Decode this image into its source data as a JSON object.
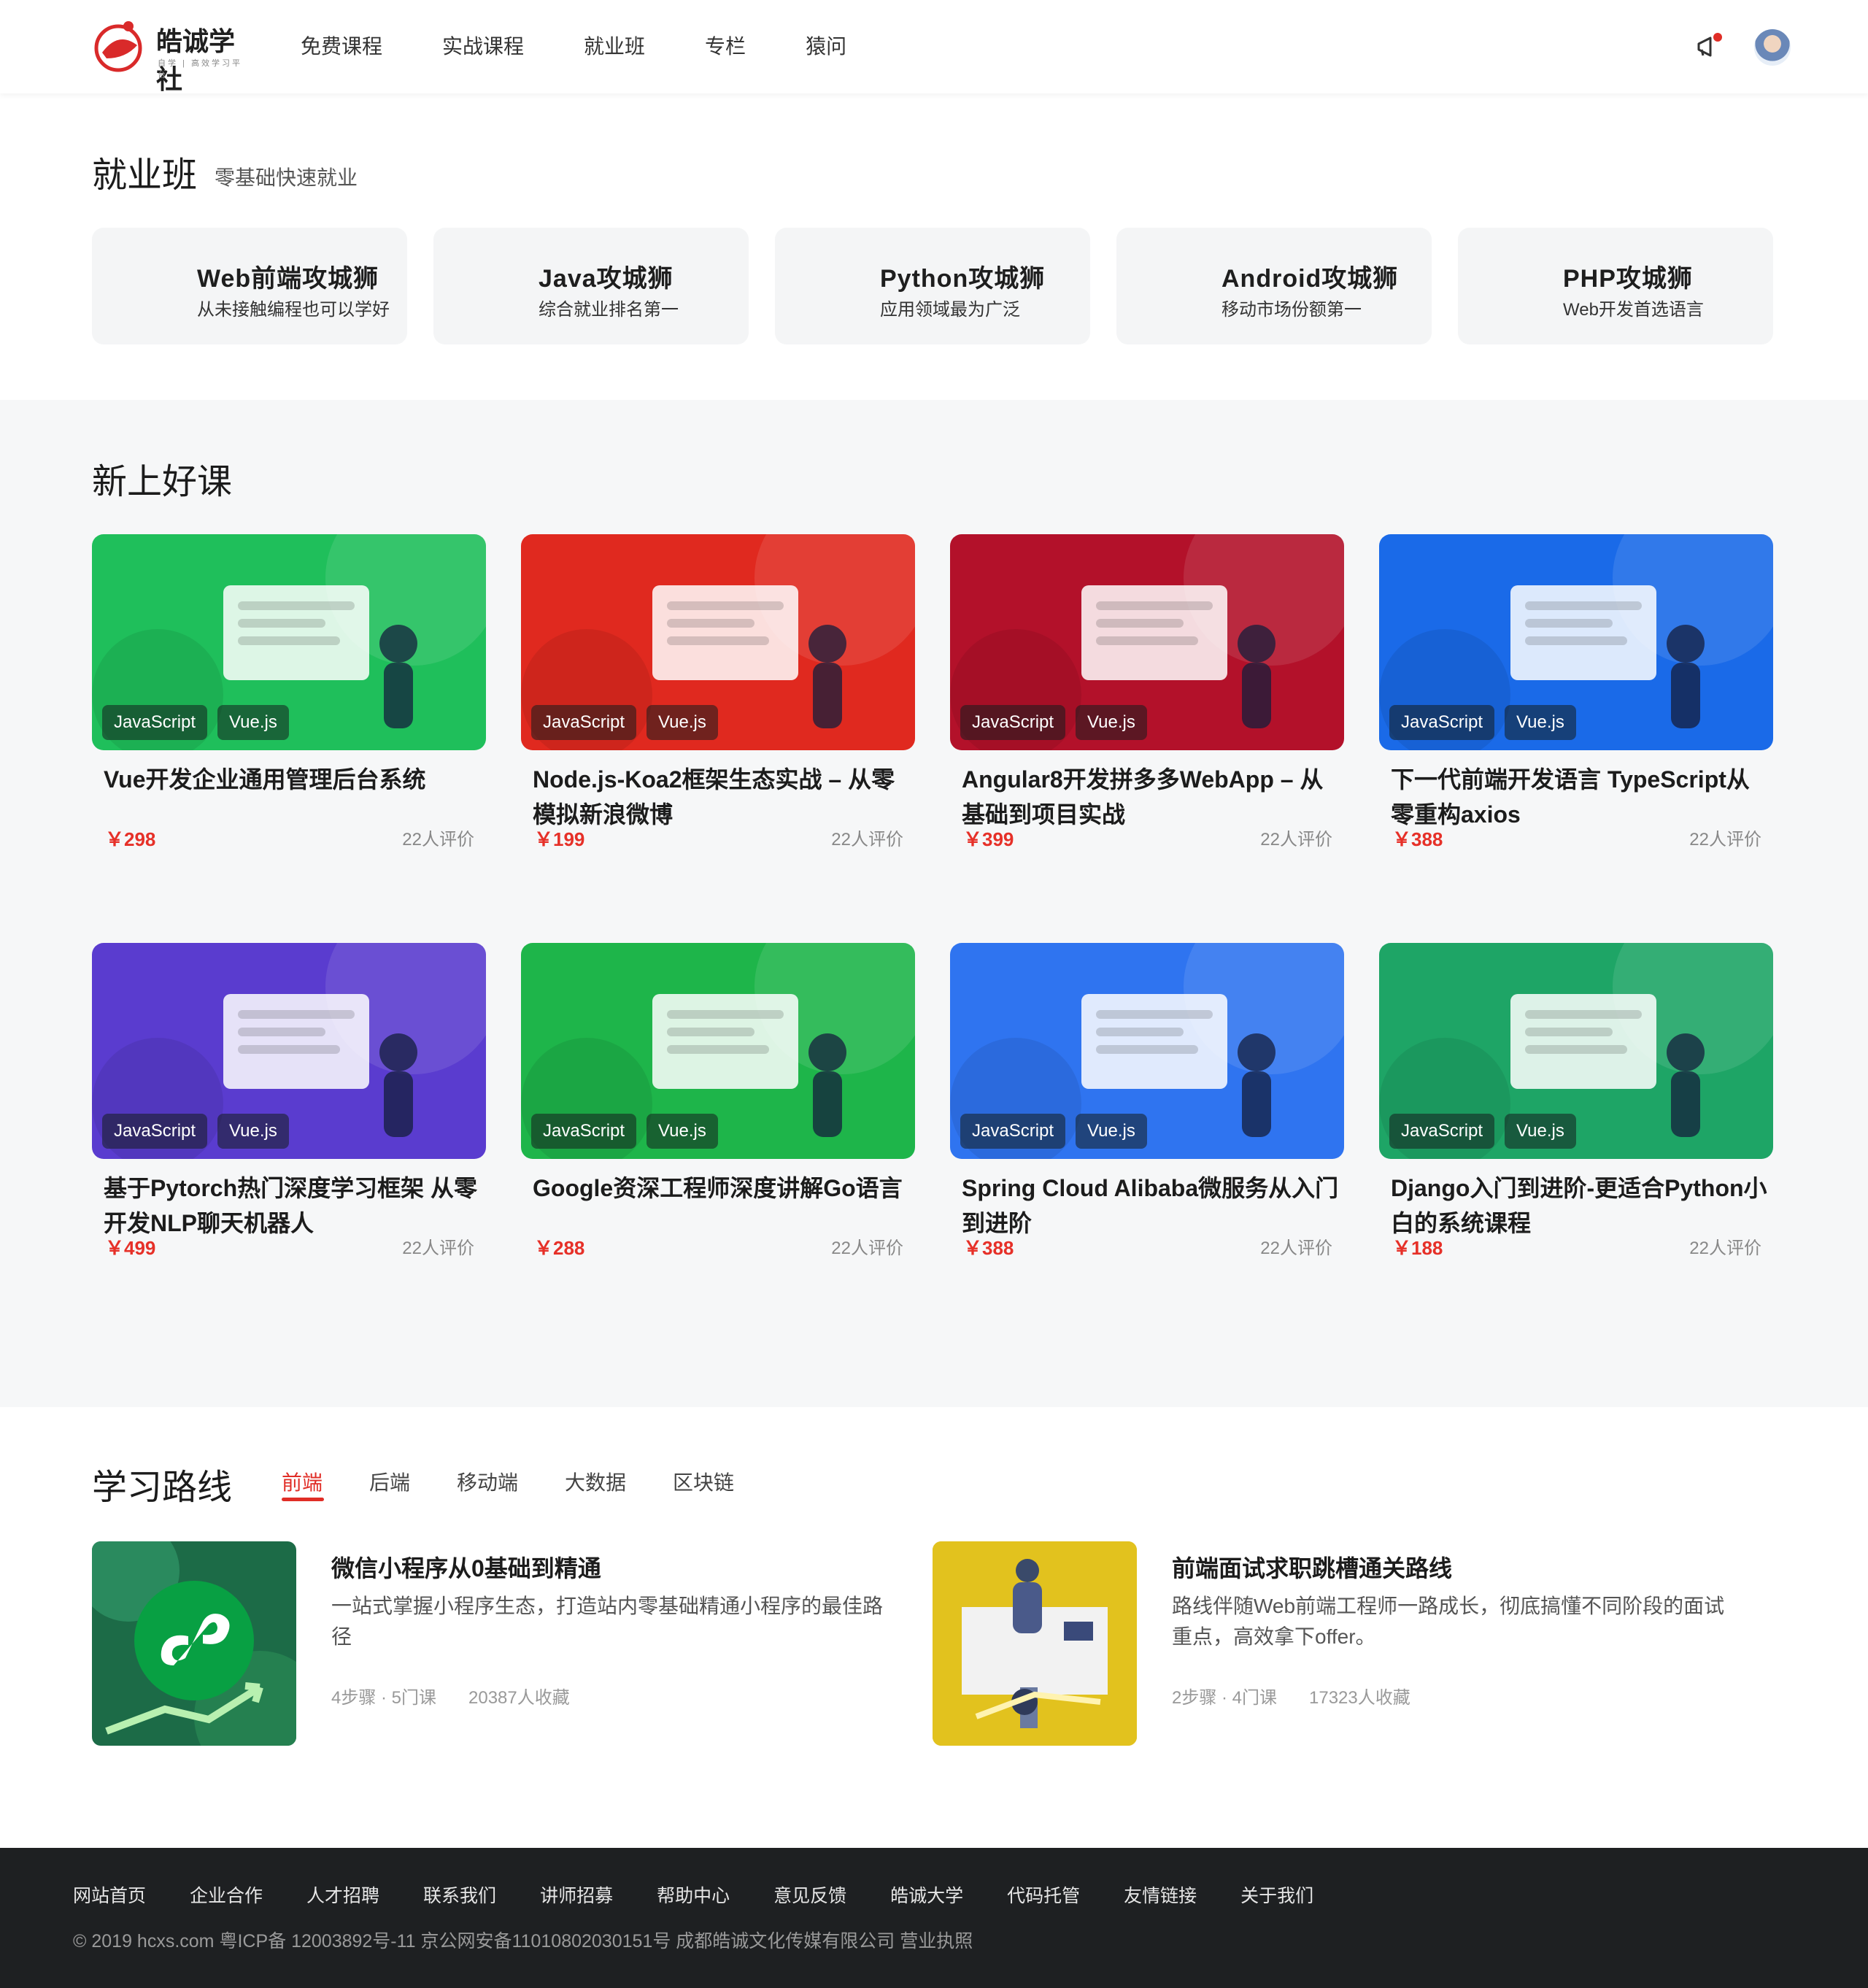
{
  "header": {
    "logo_text": "皓诚学社",
    "logo_sub": "自学 | 高效学习平台",
    "nav": [
      "免费课程",
      "实战课程",
      "就业班",
      "专栏",
      "猿问"
    ]
  },
  "employment": {
    "title": "就业班",
    "subtitle": "零基础快速就业",
    "cards": [
      {
        "title": "Web前端攻城狮",
        "desc": "从未接触编程也可以学好"
      },
      {
        "title": "Java攻城狮",
        "desc": "综合就业排名第一"
      },
      {
        "title": "Python攻城狮",
        "desc": "应用领域最为广泛"
      },
      {
        "title": "Android攻城狮",
        "desc": "移动市场份额第一"
      },
      {
        "title": "PHP攻城狮",
        "desc": "Web开发首选语言"
      }
    ]
  },
  "new_courses": {
    "title": "新上好课",
    "tag1": "JavaScript",
    "tag2": "Vue.js",
    "items": [
      {
        "title": "Vue开发企业通用管理后台系统",
        "price": "￥298",
        "reviews": "22人评价",
        "color": "#1fbf5b"
      },
      {
        "title": "Node.js-Koa2框架生态实战 – 从零模拟新浪微博",
        "price": "￥199",
        "reviews": "22人评价",
        "color": "#e0291f"
      },
      {
        "title": "Angular8开发拼多多WebApp – 从基础到项目实战",
        "price": "￥399",
        "reviews": "22人评价",
        "color": "#b3112a"
      },
      {
        "title": "下一代前端开发语言 TypeScript从零重构axios",
        "price": "￥388",
        "reviews": "22人评价",
        "color": "#1a6ae8"
      },
      {
        "title": "基于Pytorch热门深度学习框架 从零开发NLP聊天机器人",
        "price": "￥499",
        "reviews": "22人评价",
        "color": "#5a3ccf"
      },
      {
        "title": "Google资深工程师深度讲解Go语言",
        "price": "￥288",
        "reviews": "22人评价",
        "color": "#1eb54a"
      },
      {
        "title": "Spring Cloud Alibaba微服务从入门到进阶",
        "price": "￥388",
        "reviews": "22人评价",
        "color": "#2f74f0"
      },
      {
        "title": "Django入门到进阶-更适合Python小白的系统课程",
        "price": "￥188",
        "reviews": "22人评价",
        "color": "#1ea566"
      }
    ]
  },
  "learning_path": {
    "title": "学习路线",
    "tabs": [
      "前端",
      "后端",
      "移动端",
      "大数据",
      "区块链"
    ],
    "items": [
      {
        "title": "微信小程序从0基础到精通",
        "desc": "一站式掌握小程序生态，打造站内零基础精通小程序的最佳路径",
        "steps": "4步骤 · 5门课",
        "favs": "20387人收藏"
      },
      {
        "title": "前端面试求职跳槽通关路线",
        "desc": "路线伴随Web前端工程师一路成长，彻底搞懂不同阶段的面试重点，高效拿下offer。",
        "steps": "2步骤 · 4门课",
        "favs": "17323人收藏"
      }
    ]
  },
  "footer": {
    "links": [
      "网站首页",
      "企业合作",
      "人才招聘",
      "联系我们",
      "讲师招募",
      "帮助中心",
      "意见反馈",
      "皓诚大学",
      "代码托管",
      "友情链接",
      "关于我们"
    ],
    "copyright": "© 2019 hcxs.com  粤ICP备 12003892号-11 京公网安备11010802030151号 成都皓诚文化传媒有限公司 营业执照"
  }
}
